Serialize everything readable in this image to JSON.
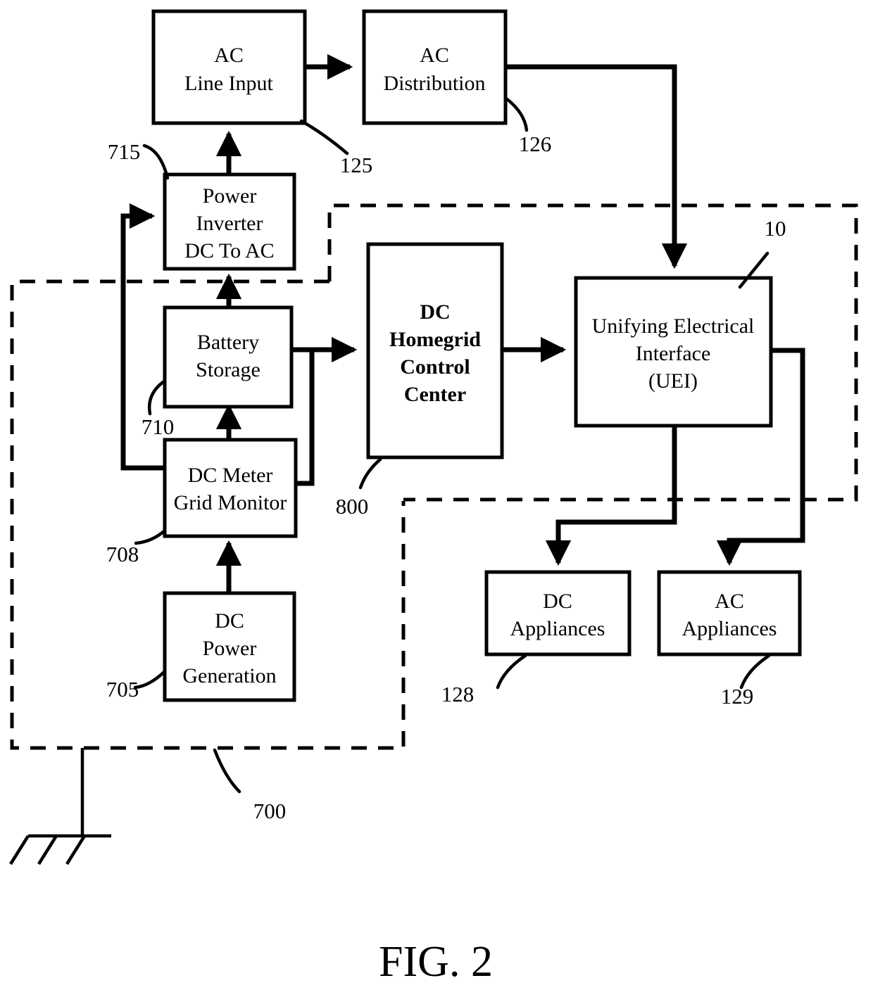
{
  "figure": {
    "caption": "FIG. 2",
    "type": "patent-block-diagram"
  },
  "blocks": [
    {
      "id": "ac_line_input",
      "line1": "AC",
      "line2": "Line Input",
      "line3": "",
      "line4": "",
      "bold": false
    },
    {
      "id": "ac_distribution",
      "line1": "AC",
      "line2": "Distribution",
      "line3": "",
      "line4": "",
      "bold": false
    },
    {
      "id": "power_inverter",
      "line1": "Power",
      "line2": "Inverter",
      "line3": "DC To AC",
      "line4": "",
      "bold": false
    },
    {
      "id": "battery_storage",
      "line1": "Battery",
      "line2": "Storage",
      "line3": "",
      "line4": "",
      "bold": false
    },
    {
      "id": "dc_meter",
      "line1": "DC Meter",
      "line2": "Grid Monitor",
      "line3": "",
      "line4": "",
      "bold": false
    },
    {
      "id": "dc_power_gen",
      "line1": "DC",
      "line2": "Power",
      "line3": "Generation",
      "line4": "",
      "bold": false
    },
    {
      "id": "control_center",
      "line1": "DC",
      "line2": "Homegrid",
      "line3": "Control",
      "line4": "Center",
      "bold": true
    },
    {
      "id": "uei",
      "line1": "Unifying Electrical",
      "line2": "Interface",
      "line3": "(UEI)",
      "line4": "",
      "bold": false
    },
    {
      "id": "dc_appliances",
      "line1": "DC",
      "line2": "Appliances",
      "line3": "",
      "line4": "",
      "bold": false
    },
    {
      "id": "ac_appliances",
      "line1": "AC",
      "line2": "Appliances",
      "line3": "",
      "line4": "",
      "bold": false
    }
  ],
  "reference_numerals": [
    {
      "id": "ref_715",
      "value": "715"
    },
    {
      "id": "ref_125",
      "value": "125"
    },
    {
      "id": "ref_126",
      "value": "126"
    },
    {
      "id": "ref_10",
      "value": "10"
    },
    {
      "id": "ref_710",
      "value": "710"
    },
    {
      "id": "ref_708",
      "value": "708"
    },
    {
      "id": "ref_705",
      "value": "705"
    },
    {
      "id": "ref_800",
      "value": "800"
    },
    {
      "id": "ref_700",
      "value": "700"
    },
    {
      "id": "ref_128",
      "value": "128"
    },
    {
      "id": "ref_129",
      "value": "129"
    }
  ],
  "colors": {
    "ink": "#000000",
    "paper": "#ffffff"
  }
}
